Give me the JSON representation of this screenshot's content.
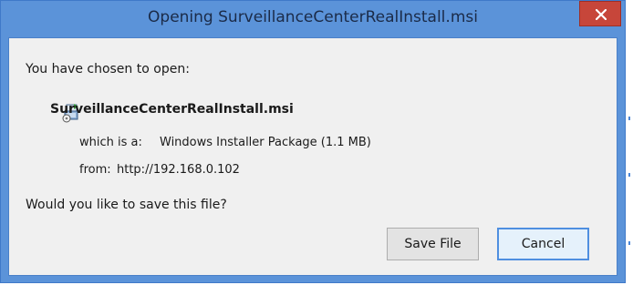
{
  "dialog": {
    "title": "Opening SurveillanceCenterRealInstall.msi",
    "intro": "You have chosen to open:",
    "file_name": "SurveillanceCenterRealInstall.msi",
    "type_label": "which is a:",
    "type_value": "Windows Installer Package (1.1 MB)",
    "from_label": "from:",
    "from_value": "http://192.168.0.102",
    "question": "Would you like to save this file?",
    "save_button": "Save File",
    "cancel_button": "Cancel"
  },
  "icons": {
    "close": "close-icon",
    "file": "msi-installer-icon"
  },
  "colors": {
    "titlebar": "#5b93d9",
    "close_button": "#c7463a",
    "client_background": "#f0f0f0",
    "cancel_focus_border": "#4f8fe0"
  }
}
